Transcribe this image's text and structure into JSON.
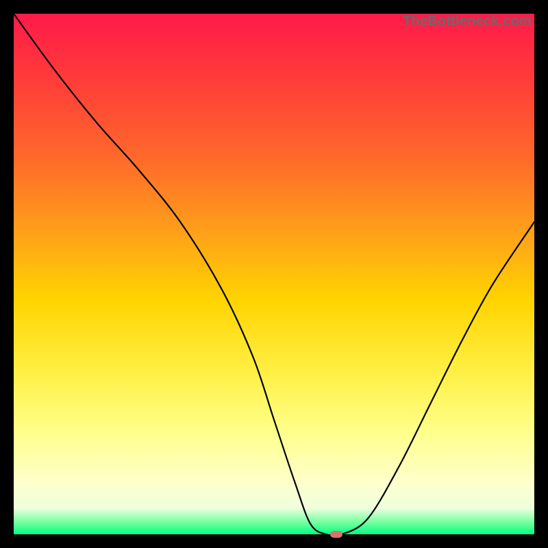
{
  "watermark": "TheBottleneck.com",
  "chart_data": {
    "type": "line",
    "title": "",
    "xlabel": "",
    "ylabel": "",
    "xlim": [
      0,
      100
    ],
    "ylim": [
      0,
      100
    ],
    "grid": false,
    "legend": false,
    "series": [
      {
        "name": "bottleneck-curve",
        "x": [
          0,
          8,
          16,
          24,
          32,
          40,
          46,
          50,
          54,
          57,
          60,
          63,
          68,
          74,
          80,
          86,
          92,
          100
        ],
        "values": [
          100,
          89,
          79,
          70,
          60,
          47,
          34,
          22,
          10,
          2,
          0,
          0,
          3,
          13,
          25,
          37,
          48,
          60
        ]
      }
    ],
    "marker": {
      "x": 62,
      "y": 0,
      "color": "#d9736b"
    },
    "gradient_stops": [
      {
        "pos": 0,
        "color": "#ff1a4a"
      },
      {
        "pos": 12,
        "color": "#ff3a3a"
      },
      {
        "pos": 28,
        "color": "#ff6a2a"
      },
      {
        "pos": 42,
        "color": "#ffa01a"
      },
      {
        "pos": 55,
        "color": "#ffd400"
      },
      {
        "pos": 68,
        "color": "#ffee40"
      },
      {
        "pos": 80,
        "color": "#ffff88"
      },
      {
        "pos": 90,
        "color": "#ffffcc"
      },
      {
        "pos": 95,
        "color": "#eeffdd"
      },
      {
        "pos": 98,
        "color": "#66ff99"
      },
      {
        "pos": 100,
        "color": "#00ff88"
      }
    ]
  }
}
